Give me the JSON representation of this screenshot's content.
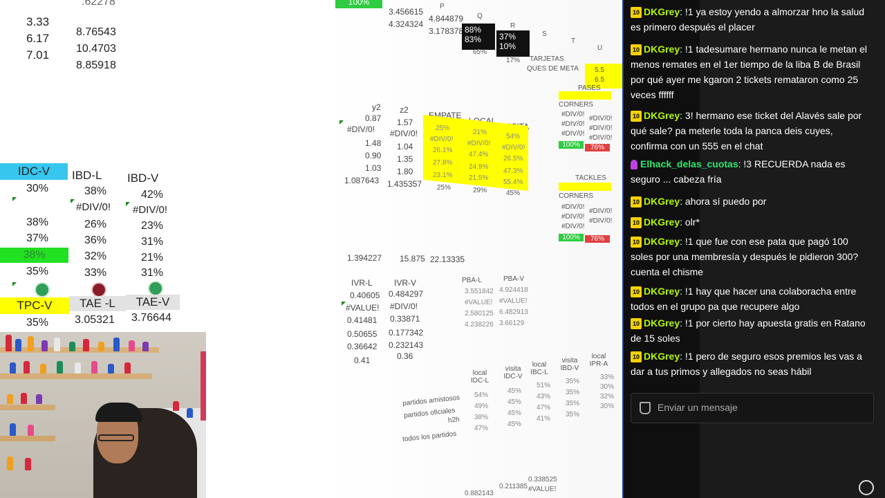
{
  "sheet": {
    "top_left": {
      "cut": ".62278",
      "r1a": "3.33",
      "r1b": "8.76543",
      "r2a": "6.17",
      "r2b": "10.4703",
      "r3a": "7.01",
      "r3b": "8.85918"
    },
    "top_mid": {
      "a1": "3.456615",
      "a2": "4.324324",
      "b1": "4.844879",
      "b2": "3.178378",
      "pct_green": "100%",
      "q1": "88%",
      "q2": "83%",
      "r1": "37%",
      "r2": "10%",
      "q3": "65%",
      "r3": "17%"
    },
    "top_cols": {
      "p": "P",
      "q": "Q",
      "r": "R",
      "s": "S",
      "t": "T",
      "u": "U"
    },
    "tarjetas": "TARJETAS",
    "ques_de_meta": "QUES DE META",
    "y_box": {
      "v1": "5.5",
      "v2": "6.5"
    },
    "pases": "PASES",
    "tackles": "TACKLES",
    "corners": "CORNERS",
    "div0_short": "#DIV/0!",
    "pct_100": "100%",
    "pct_76": "76%",
    "left_table": {
      "headers": [
        "IDC-V",
        "IBD-L",
        "IBD-V"
      ],
      "rows": [
        [
          "30%",
          "38%",
          "42%"
        ],
        [
          "",
          "#DIV/0!",
          "#DIV/0!"
        ],
        [
          "38%",
          "26%",
          "23%"
        ],
        [
          "37%",
          "36%",
          "31%"
        ],
        [
          "38%",
          "32%",
          "21%"
        ],
        [
          "35%",
          "33%",
          "31%"
        ]
      ],
      "headers2": [
        "TPC-V",
        "TAE -L",
        "TAE-V"
      ],
      "row2": [
        "35%",
        "3.05321",
        "3.76644"
      ]
    },
    "yz": {
      "y_label": "y2",
      "z_label": "z2",
      "y": [
        "0.87",
        "#DIV/0!",
        "1.48",
        "0.90",
        "1.03",
        "1.087643"
      ],
      "z": [
        "1.57",
        "#DIV/0!",
        "1.04",
        "1.35",
        "1.80",
        "1.435357"
      ]
    },
    "elv": {
      "headers": [
        "EMPATE",
        "LOCAL",
        "VISITA"
      ],
      "rows": [
        [
          "25%",
          "21%",
          "54%"
        ],
        [
          "#DIV/0!",
          "#DIV/0!",
          "#DIV/0!"
        ],
        [
          "26.1%",
          "47.4%",
          "26.5%"
        ],
        [
          "27.8%",
          "24.9%",
          "47.3%"
        ],
        [
          "23.1%",
          "21.5%",
          "55.4%"
        ]
      ],
      "foot": [
        "25%",
        "29%",
        "45%"
      ]
    },
    "mid_vals": [
      "1.394227",
      "15.875",
      "22.13335"
    ],
    "ivr": {
      "headers": [
        "IVR-L",
        "IVR-V"
      ],
      "rows": [
        [
          "0.40605",
          "0.484297"
        ],
        [
          "#VALUE!",
          "#DIV/0!"
        ],
        [
          "0.41481",
          "0.33871"
        ],
        [
          "0.50655",
          "0.177342"
        ],
        [
          "0.36642",
          "0.232143"
        ],
        [
          "0.41",
          "0.36"
        ]
      ]
    },
    "pba": {
      "headers": [
        "PBA-L",
        "PBA-V"
      ],
      "rows": [
        [
          "3.551842",
          "4.924418"
        ],
        [
          "#VALUE!",
          "#VALUE!"
        ],
        [
          "2.580125",
          "6.482913"
        ],
        [
          "4.238226",
          "3.66129"
        ]
      ]
    },
    "bottom": {
      "row_labels": [
        "partidos amistosos",
        "partidos oficiales",
        "h2h",
        "todos los partidos"
      ],
      "col_headers": [
        "local IDC-L",
        "visita IDC-V",
        "local IBC-L",
        "visita IBD-V",
        "local IPR-A"
      ],
      "col1": [
        "54%",
        "49%",
        "38%",
        "47%"
      ],
      "col2": [
        "45%",
        "45%",
        "45%",
        "45%"
      ],
      "col3": [
        "51%",
        "43%",
        "47%",
        "41%"
      ],
      "col4": [
        "35%",
        "35%",
        "35%",
        "35%"
      ],
      "col5": [
        "33%",
        "30%",
        "32%",
        "30%"
      ],
      "last_row": [
        "0.882143",
        "0.211385",
        "0.338525"
      ],
      "last_err": "#VALUE!"
    }
  },
  "chat": {
    "messages": [
      {
        "badge": "10",
        "user": "DKGrey",
        "text": ": !1 ya estoy yendo a almorzar hno la salud es primero después el placer"
      },
      {
        "badge": "10",
        "user": "DKGrey",
        "text": ": !1 tadesumare hermano nunca le metan el menos remates en el 1er tiempo de la liba B de Brasil por qué ayer me kgaron 2 tickets remataron como 25 veces ffffff"
      },
      {
        "badge": "10",
        "user": "DKGrey",
        "text": ": 3! hermano ese ticket del Alavés sale por qué sale? pa meterle toda la panca deis cuyes, confirma con un 555 en el chat"
      },
      {
        "badge": "",
        "user": "Elhack_delas_cuotas",
        "text": ": !3 RECUERDA nada es seguro ... cabeza fría"
      },
      {
        "badge": "10",
        "user": "DKGrey",
        "text": ": ahora sí puedo por"
      },
      {
        "badge": "10",
        "user": "DKGrey",
        "text": ": olr*"
      },
      {
        "badge": "10",
        "user": "DKGrey",
        "text": ": !1 que fue con ese pata que pagó 100 soles por una membresía y después le pidieron 300? cuenta el chisme"
      },
      {
        "badge": "10",
        "user": "DKGrey",
        "text": ": !1 hay que hacer una colaboracha entre todos en el grupo pa que recupere algo"
      },
      {
        "badge": "10",
        "user": "DKGrey",
        "text": ": !1 por cierto hay apuesta gratis en Ratano de 15 soles"
      },
      {
        "badge": "10",
        "user": "DKGrey",
        "text": ": !1 pero de seguro esos premios les vas a dar a tus primos y allegados no seas hábil"
      }
    ],
    "input_placeholder": "Enviar un mensaje"
  }
}
